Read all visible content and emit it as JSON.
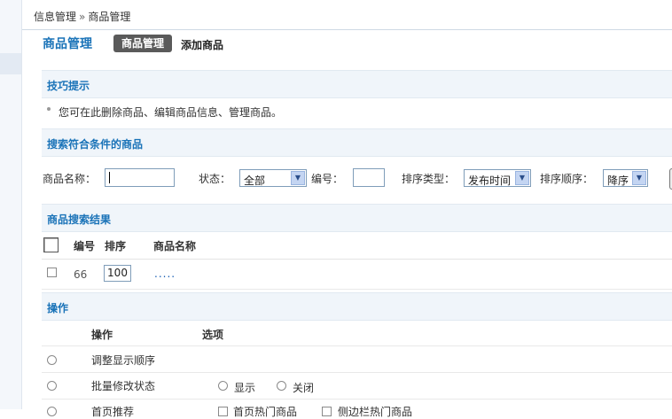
{
  "breadcrumb": {
    "part1": "信息管理",
    "sep": "»",
    "part2": "商品管理"
  },
  "page_title": "商品管理",
  "tabs": {
    "active": "商品管理",
    "add": "添加商品"
  },
  "tips": {
    "header": "技巧提示",
    "text": "您可在此删除商品、编辑商品信息、管理商品。"
  },
  "search": {
    "header": "搜索符合条件的商品",
    "name_label": "商品名称：",
    "status_label": "状态：",
    "status_value": "全部",
    "id_label": "编号：",
    "sort_type_label": "排序类型：",
    "sort_type_value": "发布时间",
    "sort_order_label": "排序顺序：",
    "sort_order_value": "降序"
  },
  "results": {
    "header": "商品搜索结果",
    "columns": {
      "id": "编号",
      "sort": "排序",
      "name": "商品名称"
    },
    "rows": [
      {
        "id": "66",
        "sort": "100",
        "name": "....."
      }
    ]
  },
  "ops": {
    "header": "操作",
    "col_op": "操作",
    "col_option": "选项",
    "rows": [
      {
        "label": "调整显示顺序"
      },
      {
        "label": "批量修改状态",
        "opt1": "显示",
        "opt2": "关闭"
      },
      {
        "label": "首页推荐",
        "opt1": "首页热门商品",
        "opt2": "侧边栏热门商品"
      }
    ]
  },
  "colors": {
    "accent": "#1a73b8",
    "section_bg": "#f0f5fa",
    "tab_active_bg": "#5a5a5a"
  },
  "icons": [
    "dropdown-arrow-icon",
    "bullet-icon"
  ]
}
